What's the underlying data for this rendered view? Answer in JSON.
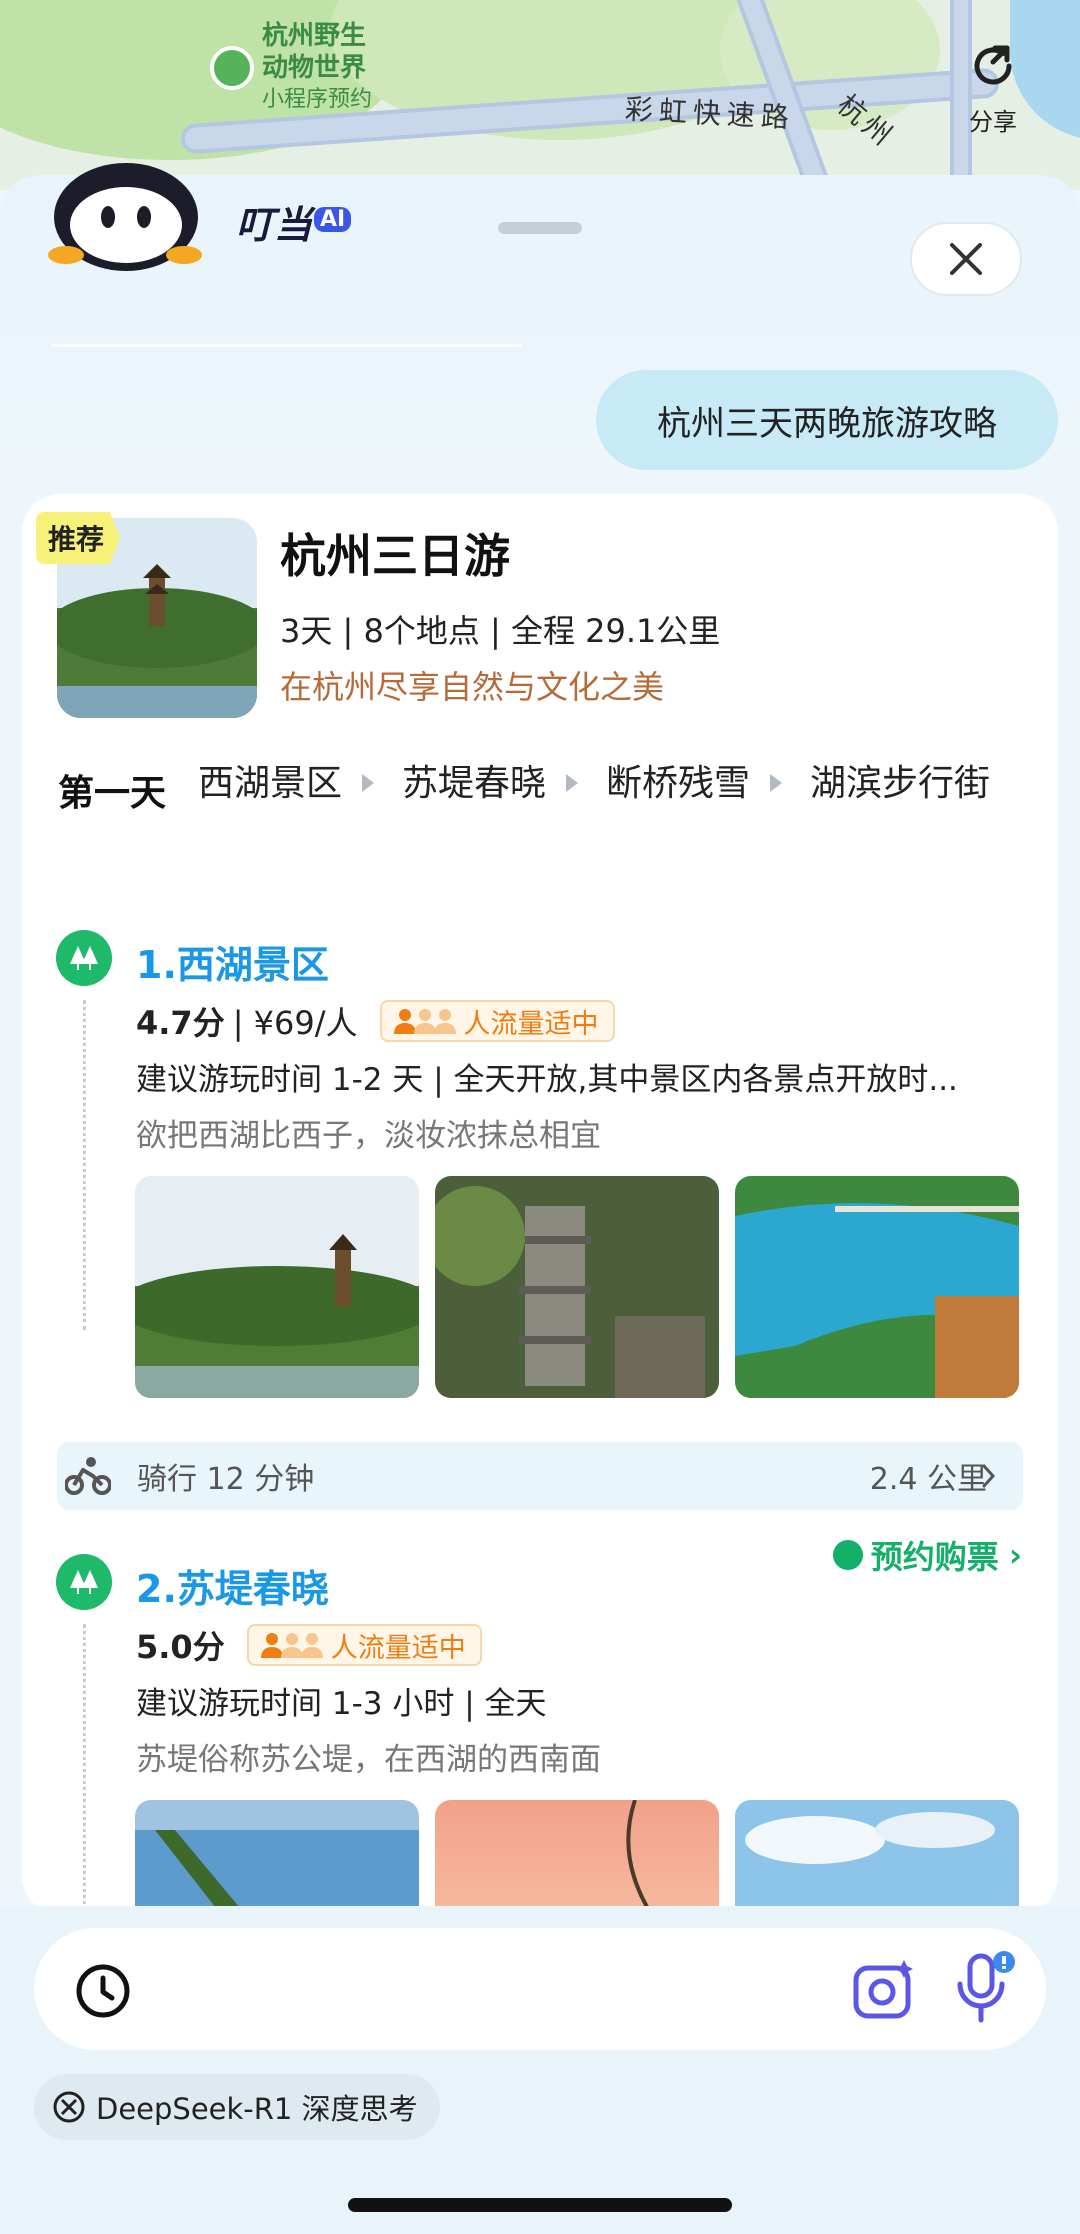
{
  "map": {
    "poi_name_line1": "杭州野生",
    "poi_name_line2": "动物世界",
    "poi_sub": "小程序预约",
    "road1": "彩虹快速路",
    "road2": "杭州",
    "share_label": "分享"
  },
  "header": {
    "brand": "叮当",
    "brand_ai": "AI"
  },
  "chat": {
    "user_message": "杭州三天两晚旅游攻略"
  },
  "trip": {
    "tag": "推荐",
    "title": "杭州三日游",
    "meta": "3天 | 8个地点 | 全程 29.1公里",
    "slogan": "在杭州尽享自然与文化之美",
    "day_label": "第一天",
    "day_stops": [
      "西湖景区",
      "苏堤春晓",
      "断桥残雪",
      "湖滨步行街"
    ]
  },
  "spots": [
    {
      "title": "1.西湖景区",
      "score": "4.7分",
      "price": "| ¥69/人",
      "crowd": "人流量适中",
      "advice": "建议游玩时间 1-2 天 | 全天开放,其中景区内各景点开放时...",
      "desc": "欲把西湖比西子，淡妆浓抹总相宜"
    },
    {
      "title": "2.苏堤春晓",
      "score": "5.0分",
      "crowd": "人流量适中",
      "advice": "建议游玩时间 1-3 小时 | 全天",
      "desc": "苏堤俗称苏公堤，在西湖的西南面",
      "ticket": "预约购票"
    }
  ],
  "ride": {
    "label": "骑行  12 分钟",
    "distance": "2.4 公里"
  },
  "footer": {
    "model_chip": "DeepSeek-R1 深度思考"
  },
  "colors": {
    "accent_blue": "#1a98e6",
    "green": "#1fb96a",
    "crowd_orange": "#f07d12",
    "slogan_brown": "#b56a38"
  }
}
